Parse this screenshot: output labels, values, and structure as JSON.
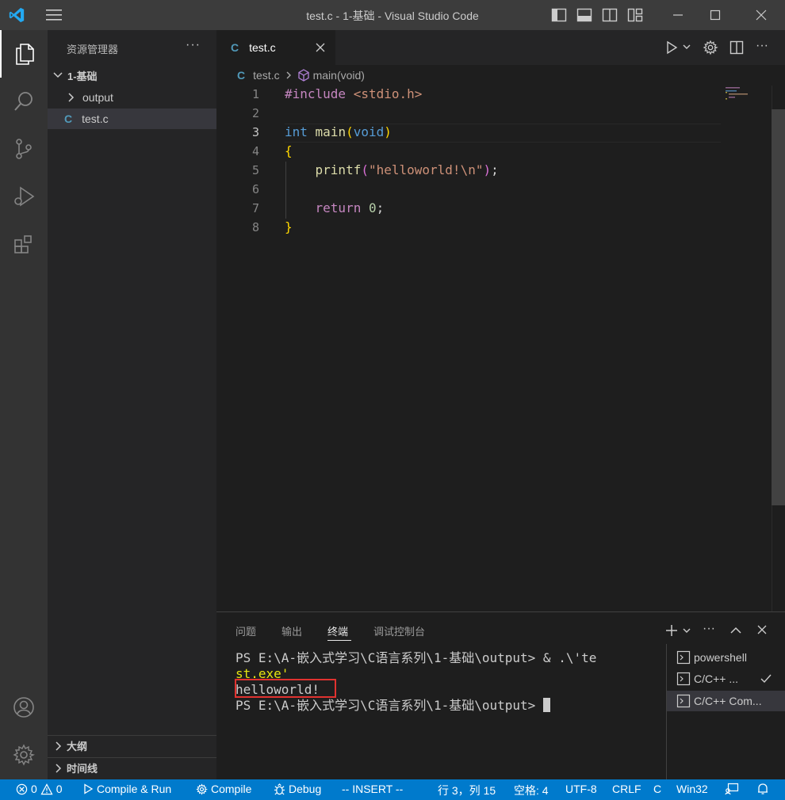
{
  "window": {
    "title": "test.c - 1-基础 - Visual Studio Code"
  },
  "sidebar": {
    "header": "资源管理器",
    "more": "···",
    "folder": "1-基础",
    "items": [
      {
        "label": "output",
        "kind": "folder"
      },
      {
        "label": "test.c",
        "kind": "file",
        "icon_letter": "C"
      }
    ],
    "sections": [
      "大纲",
      "时间线"
    ]
  },
  "editor": {
    "tab": {
      "label": "test.c",
      "icon_letter": "C"
    },
    "breadcrumb": {
      "file": "test.c",
      "symbol": "main(void)",
      "file_icon": "C"
    },
    "lines": [
      {
        "n": "1"
      },
      {
        "n": "2"
      },
      {
        "n": "3"
      },
      {
        "n": "4"
      },
      {
        "n": "5"
      },
      {
        "n": "6"
      },
      {
        "n": "7"
      },
      {
        "n": "8"
      }
    ],
    "code": {
      "include_kw": "#include",
      "include_file": "<stdio.h>",
      "type_int": "int",
      "fn_main": "main",
      "paren_open": "(",
      "type_void": "void",
      "paren_close": ")",
      "brace_open": "{",
      "fn_printf": "printf",
      "p_open": "(",
      "str": "\"helloworld!\\n\"",
      "p_close": ")",
      "semi": ";",
      "kw_return": "return",
      "num": "0",
      "semi2": ";",
      "brace_close": "}"
    }
  },
  "panel": {
    "tabs": [
      "问题",
      "输出",
      "终端",
      "调试控制台"
    ],
    "active_tab": "终端",
    "terminal": [
      "PS E:\\A-嵌入式学习\\C语言系列\\1-基础\\output> & .\\'te",
      "st.exe'",
      "helloworld!",
      "PS E:\\A-嵌入式学习\\C语言系列\\1-基础\\output> "
    ],
    "terminals": [
      {
        "label": "powershell"
      },
      {
        "label": "C/C++ ..."
      },
      {
        "label": "C/C++ Com..."
      }
    ]
  },
  "statusbar": {
    "errors": "0",
    "warnings": "0",
    "compile_run": "Compile & Run",
    "compile": "Compile",
    "debug": "Debug",
    "mode": "-- INSERT --",
    "position": "行 3，列 15",
    "indent": "空格: 4",
    "encoding": "UTF-8",
    "eol": "CRLF",
    "language": "C",
    "platform": "Win32"
  },
  "colors": {
    "accent": "#007acc",
    "keyword_pink": "#c586c0",
    "string_orange": "#ce9178",
    "type_blue": "#569cd6",
    "fn_yellow": "#dcdcaa",
    "number_green": "#b5cea8",
    "highlight_box": "#e0322f"
  }
}
